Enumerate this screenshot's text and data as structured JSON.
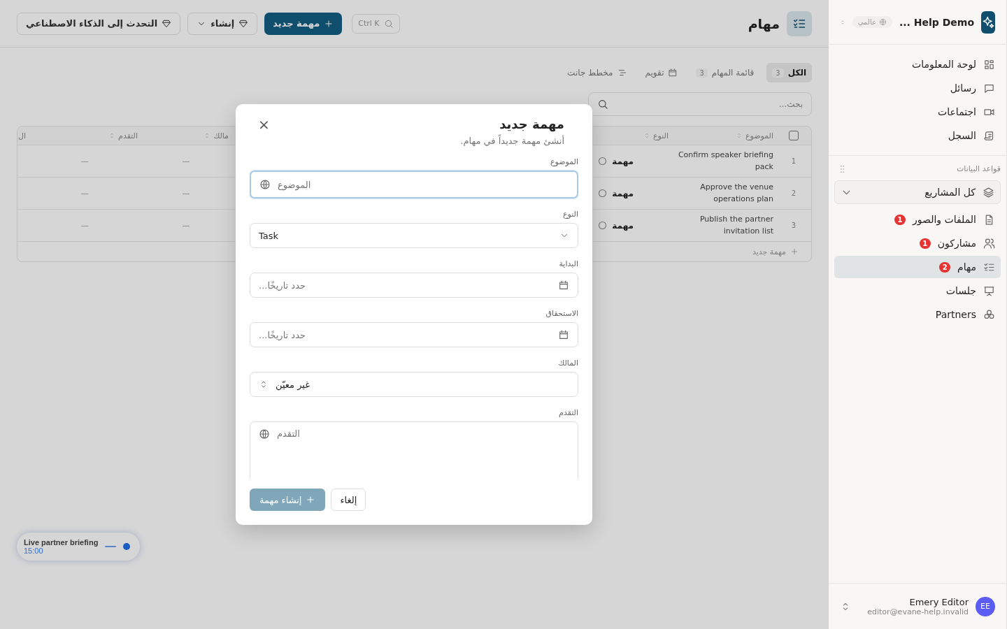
{
  "topbar": {
    "title": "مهام",
    "search_shortcut": "Ctrl K",
    "new_button": "مهمة جديد",
    "create_menu": "إنشاء",
    "ai_button": "التحدث إلى الذكاء الاصطناعي"
  },
  "view_tabs": [
    {
      "label": "الكل",
      "count": "3",
      "selected": true
    },
    {
      "label": "قائمة المهام",
      "count": "3",
      "selected": false
    },
    {
      "label": "تقويم",
      "selected": false
    },
    {
      "label": "مخطط جانت",
      "selected": false
    }
  ],
  "search": {
    "placeholder": "بحث..."
  },
  "table": {
    "select_all_checked": false,
    "columns": [
      "الموضوع",
      "النوع",
      "مالك",
      "التقدم",
      "ال"
    ],
    "rows": [
      {
        "number": "1",
        "subject": "Confirm speaker briefing pack",
        "type": "مهمة",
        "owner": "—",
        "progress": "—"
      },
      {
        "number": "2",
        "subject": "Approve the venue operations plan",
        "type": "مهمة",
        "owner": "—",
        "progress": "—"
      },
      {
        "number": "3",
        "subject": "Publish the partner invitation list",
        "type": "مهمة",
        "owner": "—",
        "progress": "—"
      }
    ],
    "add_row": "مهمة جديد"
  },
  "floating_call": {
    "title": "Live partner briefing",
    "time": "15:00"
  },
  "modal": {
    "title": "مهمة جديد",
    "subtitle": "أنشئ مهمة جديداً في مهام.",
    "close": "×",
    "fields": [
      {
        "kind": "text",
        "label": "الموضوع",
        "placeholder": "الموضوع",
        "focused": true
      },
      {
        "kind": "select",
        "label": "النوع",
        "value": "Task",
        "focused": false
      },
      {
        "kind": "date",
        "label": "البداية",
        "placeholder": "حدد تاريخًا...",
        "focused": false
      },
      {
        "kind": "date",
        "label": "الاستحقاق",
        "placeholder": "حدد تاريخًا...",
        "focused": false
      },
      {
        "kind": "picker",
        "label": "المالك",
        "value": "غير معيّن",
        "focused": false
      },
      {
        "kind": "textarea",
        "label": "التقدم",
        "placeholder": "التقدم",
        "focused": false
      }
    ],
    "submit": {
      "label": "إنشاء مهمة",
      "disabled": true
    },
    "cancel": "إلغاء"
  },
  "sidebar": {
    "workspace": "Help Demo ...",
    "scope": "عالمي",
    "nav": [
      {
        "label": "لوحة المعلومات"
      },
      {
        "label": "رسائل"
      },
      {
        "label": "اجتماعات"
      },
      {
        "label": "السجل"
      }
    ],
    "section_title": "قواعد البيانات",
    "project_select": "كل المشاريع",
    "databases": [
      {
        "label": "الملفات والصور",
        "badge": "1",
        "selected": false
      },
      {
        "label": "مشاركون",
        "badge": "1",
        "selected": false
      },
      {
        "label": "مهام",
        "badge": "2",
        "selected": true
      },
      {
        "label": "جلسات",
        "selected": false
      },
      {
        "label": "Partners",
        "selected": false
      }
    ],
    "user": {
      "name": "Emery Editor",
      "email": "editor@evane-help.invalid",
      "initials": "EE"
    }
  }
}
